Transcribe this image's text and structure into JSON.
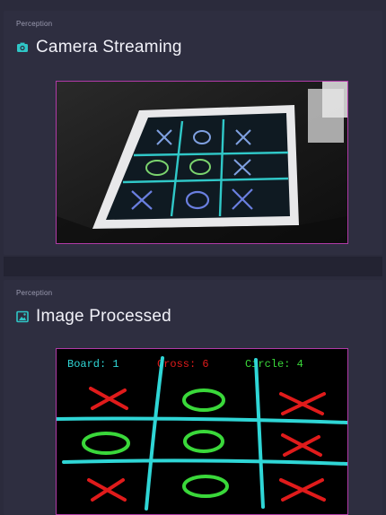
{
  "camera_panel": {
    "category": "Perception",
    "title": "Camera Streaming",
    "icon": "camera-icon",
    "accent": "#2fc6c6"
  },
  "processed_panel": {
    "category": "Perception",
    "title": "Image Processed",
    "icon": "image-icon",
    "accent": "#2fc6c6",
    "overlay": {
      "board_label": "Board: 1",
      "cross_label": "Cross: 6",
      "circle_label": "Circle: 4",
      "board_color": "#2fd6d6",
      "cross_color": "#e01b1b",
      "circle_color": "#3ad83a"
    }
  },
  "frame_border_color": "#b13aa7"
}
